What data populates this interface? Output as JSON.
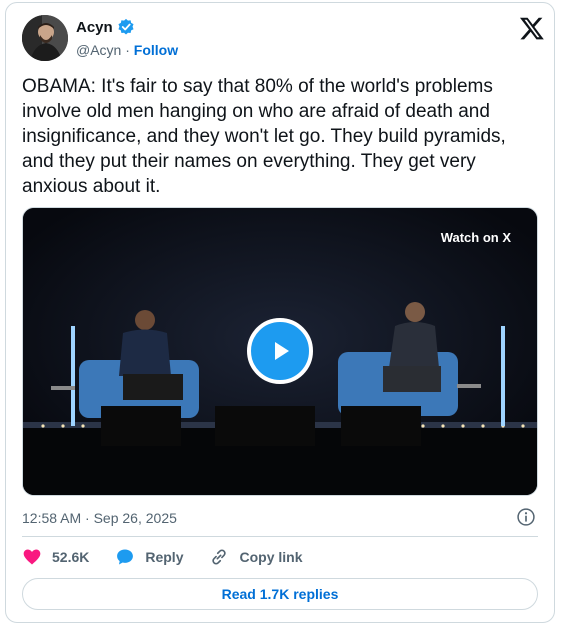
{
  "author": {
    "display_name": "Acyn",
    "handle": "@Acyn",
    "separator": " · ",
    "follow_label": "Follow"
  },
  "tweet": {
    "text": "OBAMA: It's fair to say that 80% of the world's problems involve old men hanging on who are afraid of death and insignificance, and they won't let go. They build pyramids, and they put their names on everything. They get very anxious about it."
  },
  "media": {
    "watch_label": "Watch on X"
  },
  "meta": {
    "timestamp": "12:58 AM · Sep 26, 2025"
  },
  "actions": {
    "like_count": "52.6K",
    "reply_label": "Reply",
    "copy_label": "Copy link"
  },
  "footer": {
    "read_replies_label": "Read 1.7K replies"
  },
  "colors": {
    "link_blue": "#006fd6",
    "play_blue": "#1d9bf0",
    "like_pink": "#f91880",
    "muted": "#536471"
  },
  "icons": [
    "verified-badge-icon",
    "x-logo-icon",
    "play-icon",
    "info-icon",
    "heart-icon",
    "reply-bubble-icon",
    "link-icon"
  ]
}
